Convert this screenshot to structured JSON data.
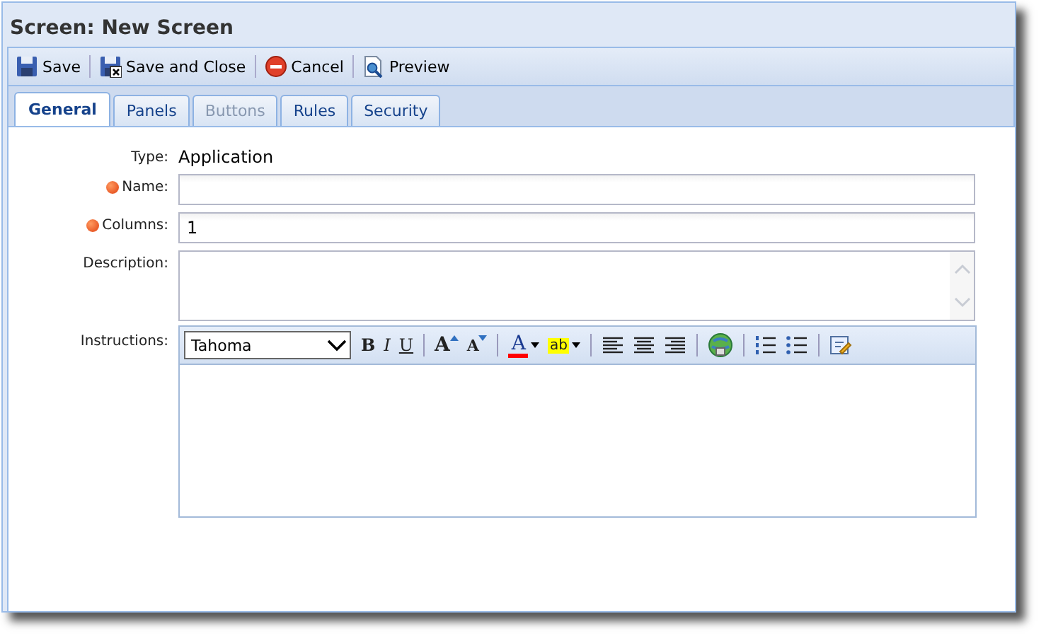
{
  "window": {
    "title": "Screen: New Screen"
  },
  "toolbar": [
    {
      "kind": "save",
      "label": "Save"
    },
    {
      "kind": "save-close",
      "label": "Save and Close"
    },
    {
      "kind": "cancel",
      "label": "Cancel"
    },
    {
      "kind": "preview",
      "label": "Preview"
    }
  ],
  "tabs": [
    {
      "label": "General",
      "selected": true,
      "disabled": false
    },
    {
      "label": "Panels",
      "selected": false,
      "disabled": false
    },
    {
      "label": "Buttons",
      "selected": false,
      "disabled": true
    },
    {
      "label": "Rules",
      "selected": false,
      "disabled": false
    },
    {
      "label": "Security",
      "selected": false,
      "disabled": false
    }
  ],
  "form": {
    "type": {
      "label": "Type:",
      "value": "Application"
    },
    "fields": [
      {
        "kind": "input",
        "label": "Name:",
        "required": true
      },
      {
        "kind": "input",
        "label": "Columns:",
        "required": true,
        "value": "1"
      },
      {
        "kind": "textarea",
        "label": "Description:",
        "required": false
      }
    ],
    "instructions": {
      "label": "Instructions:",
      "font": "Tahoma",
      "tools": [
        {
          "kind": "bold",
          "label": "B"
        },
        {
          "kind": "italic",
          "label": "I"
        },
        {
          "kind": "underline",
          "label": "U"
        },
        {
          "kind": "sep"
        },
        {
          "kind": "grow",
          "label": "A"
        },
        {
          "kind": "shrink",
          "label": "A"
        },
        {
          "kind": "sep"
        },
        {
          "kind": "color",
          "label": "A",
          "color": "#ff0000"
        },
        {
          "kind": "highlight",
          "label": "ab",
          "color": "#ffff00"
        },
        {
          "kind": "sep"
        },
        {
          "kind": "align-left"
        },
        {
          "kind": "align-center"
        },
        {
          "kind": "align-right"
        },
        {
          "kind": "sep"
        },
        {
          "kind": "link"
        },
        {
          "kind": "sep"
        },
        {
          "kind": "ordered-list"
        },
        {
          "kind": "bullet-list"
        },
        {
          "kind": "sep"
        },
        {
          "kind": "source"
        }
      ]
    }
  }
}
